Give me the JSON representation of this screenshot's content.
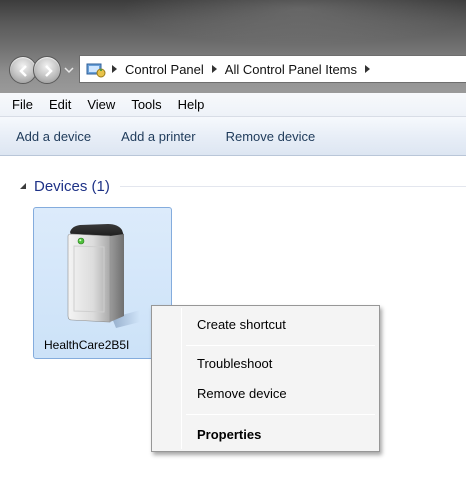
{
  "address_bar": {
    "breadcrumbs": [
      "Control Panel",
      "All Control Panel Items"
    ]
  },
  "menu_bar": {
    "items": [
      "File",
      "Edit",
      "View",
      "Tools",
      "Help"
    ]
  },
  "command_bar": {
    "buttons": [
      "Add a device",
      "Add a printer",
      "Remove device"
    ]
  },
  "devices_group": {
    "title": "Devices (1)",
    "device": {
      "label": "HealthCare2B5I",
      "icon": "external-drive-icon"
    }
  },
  "context_menu": {
    "items": {
      "create_shortcut": "Create shortcut",
      "troubleshoot": "Troubleshoot",
      "remove_device": "Remove device",
      "properties": "Properties"
    }
  },
  "colors": {
    "accent_text": "#1e3287",
    "selection_fill": "#cce2f8",
    "selection_border": "#84acdd"
  }
}
